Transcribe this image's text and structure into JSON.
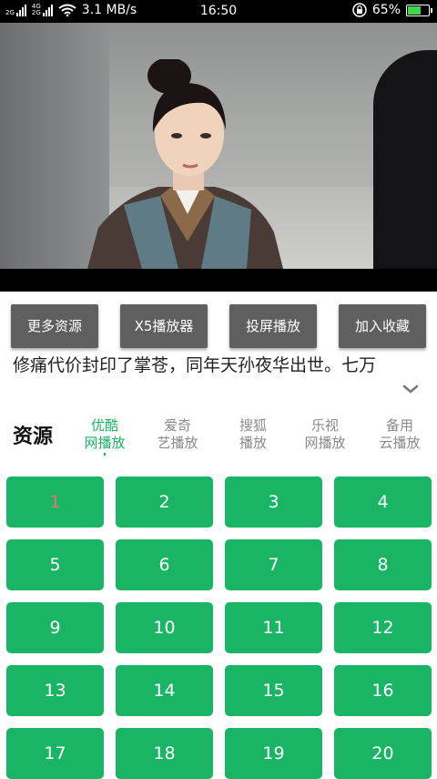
{
  "status_bar": {
    "net1": "2G",
    "net2": "4G",
    "net3": "2G",
    "speed": "3.1 MB/s",
    "time": "16:50",
    "battery": "65%",
    "battery_level": 0.65
  },
  "actions": {
    "more_sources": "更多资源",
    "x5_player": "X5播放器",
    "cast_play": "投屏播放",
    "favorite": "加入收藏"
  },
  "description": "修痛代价封印了掌苍，同年天孙夜华出世。七万",
  "sources": {
    "title": "资源",
    "tabs": [
      {
        "line1": "优酷",
        "line2": "网播放",
        "active": true
      },
      {
        "line1": "爱奇",
        "line2": "艺播放"
      },
      {
        "line1": "搜狐",
        "line2": "播放"
      },
      {
        "line1": "乐视",
        "line2": "网播放"
      },
      {
        "line1": "备用",
        "line2": "云播放"
      }
    ]
  },
  "episodes": [
    "1",
    "2",
    "3",
    "4",
    "5",
    "6",
    "7",
    "8",
    "9",
    "10",
    "11",
    "12",
    "13",
    "14",
    "15",
    "16",
    "17",
    "18",
    "19",
    "20"
  ],
  "current_episode": "1",
  "colors": {
    "accent": "#19b464",
    "current_episode_text": "#e3737f",
    "button_gray": "#5f5f5f"
  }
}
